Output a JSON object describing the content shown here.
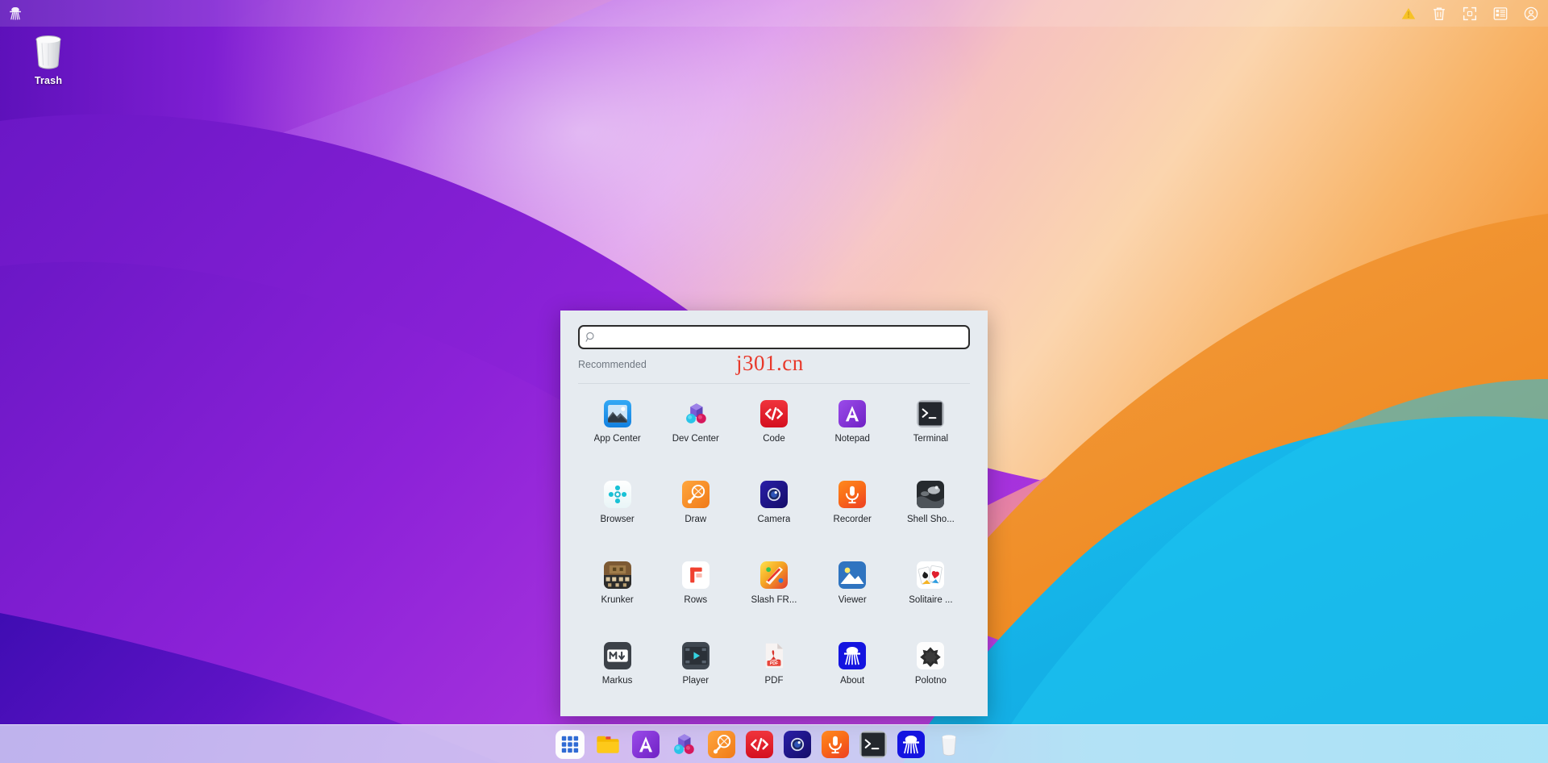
{
  "desktop": {
    "icons": [
      {
        "name": "Trash",
        "icon": "trash-icon"
      }
    ]
  },
  "topbar": {
    "logo": {
      "name": "about-logo-icon"
    },
    "right_icons": [
      {
        "name": "warning-icon",
        "label": "Warning"
      },
      {
        "name": "trash-icon",
        "label": "Trash"
      },
      {
        "name": "fullscreen-icon",
        "label": "Fullscreen"
      },
      {
        "name": "apps-list-icon",
        "label": "Apps"
      },
      {
        "name": "account-icon",
        "label": "Account"
      }
    ]
  },
  "launcher": {
    "search": {
      "value": "",
      "placeholder": ""
    },
    "section_label": "Recommended",
    "watermark": "j301.cn",
    "apps": [
      {
        "label": "App Center",
        "icon": "app-center-icon"
      },
      {
        "label": "Dev Center",
        "icon": "dev-center-icon"
      },
      {
        "label": "Code",
        "icon": "code-icon"
      },
      {
        "label": "Notepad",
        "icon": "notepad-icon"
      },
      {
        "label": "Terminal",
        "icon": "terminal-icon"
      },
      {
        "label": "Browser",
        "icon": "browser-icon"
      },
      {
        "label": "Draw",
        "icon": "draw-icon"
      },
      {
        "label": "Camera",
        "icon": "camera-icon"
      },
      {
        "label": "Recorder",
        "icon": "recorder-icon"
      },
      {
        "label": "Shell Sho...",
        "icon": "shell-shocked-icon"
      },
      {
        "label": "Krunker",
        "icon": "krunker-icon"
      },
      {
        "label": "Rows",
        "icon": "rows-icon"
      },
      {
        "label": "Slash FR...",
        "icon": "slash-fr-icon"
      },
      {
        "label": "Viewer",
        "icon": "viewer-icon"
      },
      {
        "label": "Solitaire ...",
        "icon": "solitaire-icon"
      },
      {
        "label": "Markus",
        "icon": "markus-icon"
      },
      {
        "label": "Player",
        "icon": "player-icon"
      },
      {
        "label": "PDF",
        "icon": "pdf-icon"
      },
      {
        "label": "About",
        "icon": "about-icon"
      },
      {
        "label": "Polotno",
        "icon": "polotno-icon"
      }
    ]
  },
  "taskbar": {
    "items": [
      {
        "label": "Show Apps",
        "icon": "grid-launcher-icon",
        "active": true
      },
      {
        "label": "Files",
        "icon": "folder-icon",
        "active": false
      },
      {
        "label": "Notepad",
        "icon": "notepad-icon",
        "active": false
      },
      {
        "label": "Dev Center",
        "icon": "dev-center-icon",
        "active": false
      },
      {
        "label": "Draw",
        "icon": "draw-icon",
        "active": false
      },
      {
        "label": "Code",
        "icon": "code-icon",
        "active": false
      },
      {
        "label": "Camera",
        "icon": "camera-icon",
        "active": false
      },
      {
        "label": "Recorder",
        "icon": "recorder-icon",
        "active": false
      },
      {
        "label": "Terminal",
        "icon": "terminal-icon",
        "active": false
      },
      {
        "label": "About",
        "icon": "about-icon",
        "active": false
      },
      {
        "label": "Trash",
        "icon": "trash-icon",
        "active": false
      }
    ]
  },
  "colors": {
    "accent_red": "#e8392b",
    "panel_bg": "#e6ebf0",
    "wallpaper_purple": "#8a23d6",
    "wallpaper_orange": "#f2912e",
    "wallpaper_cyan": "#17b6e8",
    "warning_yellow": "#f5c518"
  }
}
